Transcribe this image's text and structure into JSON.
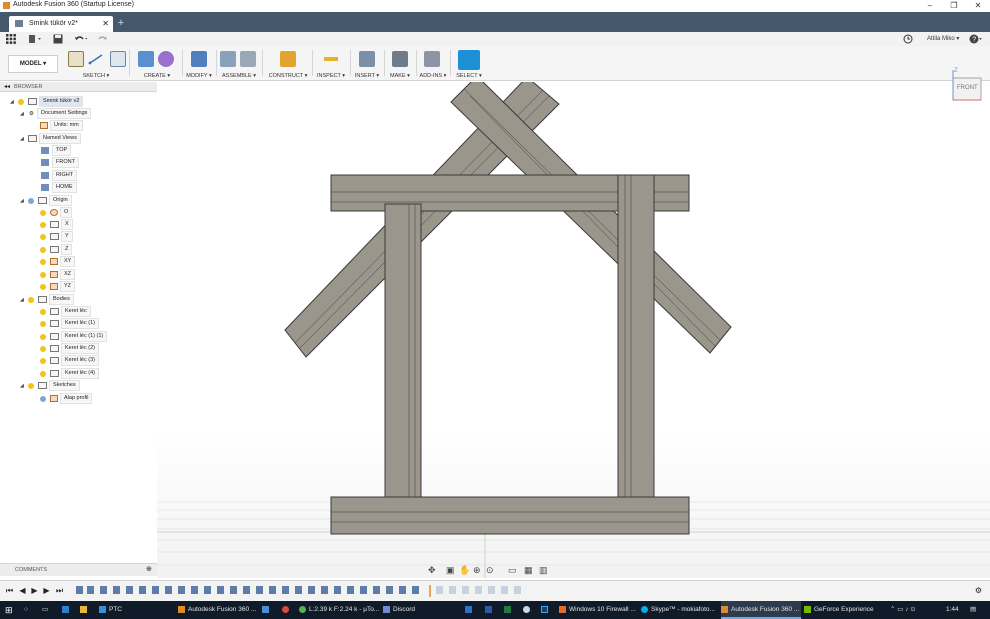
{
  "window": {
    "title": "Autodesk Fusion 360 (Startup License)",
    "controls": [
      "–",
      "❐",
      "✕"
    ]
  },
  "tabs": {
    "doc_label": "Smink tükör v2*",
    "close": "✕",
    "new_tab": "+"
  },
  "quick_access": {
    "user_name": "Attila Miko ▾",
    "help": "?"
  },
  "ribbon": {
    "workspace": "MODEL ▾",
    "groups": [
      {
        "label": "SKETCH ▾"
      },
      {
        "label": "CREATE ▾"
      },
      {
        "label": "MODIFY ▾"
      },
      {
        "label": "ASSEMBLE ▾"
      },
      {
        "label": "CONSTRUCT ▾"
      },
      {
        "label": "INSPECT ▾"
      },
      {
        "label": "INSERT ▾"
      },
      {
        "label": "MAKE ▾"
      },
      {
        "label": "ADD-INS ▾"
      },
      {
        "label": "SELECT ▾"
      }
    ]
  },
  "browser": {
    "title": "BROWSER",
    "root": "Smink tükör v2",
    "document_settings": "Document Settings",
    "units": "Units: mm",
    "named_views": "Named Views",
    "views": [
      "TOP",
      "FRONT",
      "RIGHT",
      "HOME"
    ],
    "origin": "Origin",
    "origin_items": [
      "O",
      "X",
      "Y",
      "Z",
      "XY",
      "XZ",
      "YZ"
    ],
    "bodies": "Bodies",
    "body_items": [
      "Keret léc",
      "Keret léc (1)",
      "Keret léc (1) (1)",
      "Keret léc (2)",
      "Keret léc (3)",
      "Keret léc (4)"
    ],
    "sketches": "Sketches",
    "sketch_items": [
      "Alap profil"
    ]
  },
  "viewcube": {
    "face": "FRONT",
    "axis": "Z"
  },
  "comments": {
    "title": "COMMENTS"
  },
  "taskbar": {
    "items": [
      {
        "label": "PTC"
      },
      {
        "label": "Autodesk Fusion 360 ..."
      },
      {
        "label": "L:2.39 k F:2.24 k - µTo..."
      },
      {
        "label": "Discord"
      },
      {
        "label": "Windows 10 Firewall ..."
      },
      {
        "label": "Skype™ - mokiafoto..."
      },
      {
        "label": "Autodesk Fusion 360 ..."
      },
      {
        "label": "GeForce Experience"
      }
    ],
    "clock": "1:44"
  },
  "colors": {
    "tabbar": "#46586c",
    "select_active": "#1e90d6",
    "taskbar": "#101b2a",
    "model_fill": "#9a968c",
    "model_edge": "#3a3a3a"
  }
}
